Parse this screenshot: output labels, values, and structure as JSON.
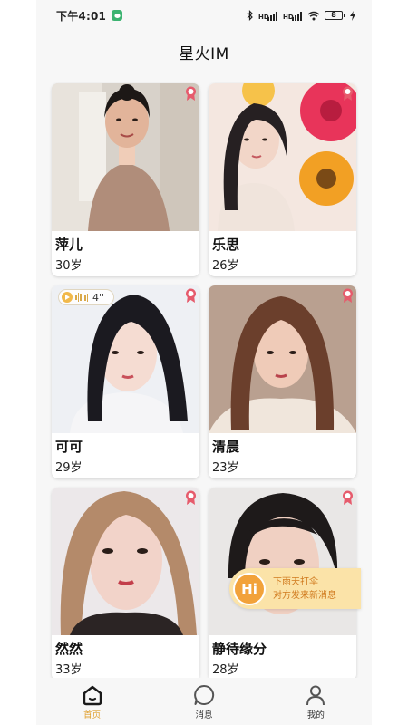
{
  "status_bar": {
    "time": "下午4:01",
    "signal_label": "HD",
    "battery": "8"
  },
  "header": {
    "title": "星火IM"
  },
  "cards": [
    {
      "name": "萍儿",
      "age": "30岁"
    },
    {
      "name": "乐思",
      "age": "26岁"
    },
    {
      "name": "可可",
      "age": "29岁",
      "voice_duration": "4''"
    },
    {
      "name": "清晨",
      "age": "23岁"
    },
    {
      "name": "然然",
      "age": "33岁"
    },
    {
      "name": "静待缘分",
      "age": "28岁"
    }
  ],
  "toast": {
    "badge": "Hi",
    "line1": "下雨天打伞",
    "line2": "对方发来新消息"
  },
  "tabbar": {
    "items": [
      {
        "label": "首页",
        "icon": "home-icon",
        "active": true
      },
      {
        "label": "消息",
        "icon": "chat-bubble-icon",
        "active": false
      },
      {
        "label": "我的",
        "icon": "person-icon",
        "active": false
      }
    ]
  },
  "colors": {
    "accent": "#e0a030",
    "toast_bg": "#fbe3a8",
    "badge": "#e65b6c"
  }
}
